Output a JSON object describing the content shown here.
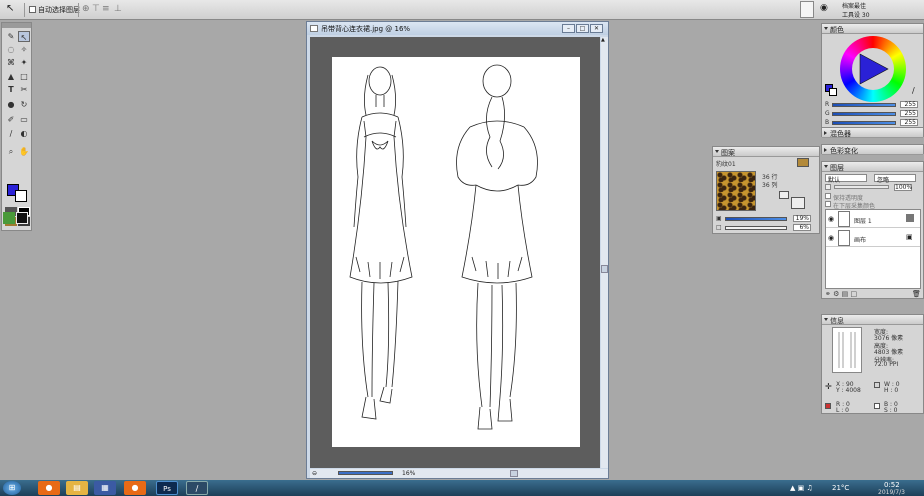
{
  "options_bar": {
    "auto_select_label": "自动选择图层"
  },
  "document": {
    "title": "吊带背心连衣裙.jpg @ 16%",
    "zoom": "16%"
  },
  "topright": {
    "row1": "档案最佳",
    "row2": "工具设 30"
  },
  "color_panel": {
    "title": "颜色",
    "channels": [
      {
        "label": "R",
        "value": "255"
      },
      {
        "label": "G",
        "value": "255"
      },
      {
        "label": "B",
        "value": "255"
      }
    ],
    "fg_color": "#2a21d6"
  },
  "color_sets_panel": {
    "title": "混色器"
  },
  "patterns_panel": {
    "title": "图案",
    "pattern_name": "豹纹01",
    "rows": "36 行",
    "cols": "36 列",
    "percent1": "19%",
    "percent2": "6%"
  },
  "color_var_panel": {
    "title": "色彩变化"
  },
  "layers_panel": {
    "title": "图层",
    "blend_mode": "默认",
    "composite": "忽略",
    "opacity": "100%",
    "opt1": "保持透明度",
    "opt2": "在下层采集颜色",
    "layers": [
      {
        "name": "图层 1"
      },
      {
        "name": "画布"
      }
    ]
  },
  "info_panel": {
    "title": "信息",
    "width_label": "宽度:",
    "width_value": "3076 像素",
    "height_label": "高度:",
    "height_value": "4803 像素",
    "res_label": "分辨率:",
    "res_value": "72.0 PPI",
    "x_label": "X : 90",
    "y_label": "Y : 4008",
    "w_label": "W : 0",
    "h_label": "H : 0",
    "r_label": "R : 0",
    "l_label": "L : 0",
    "b_label": "B : 0",
    "s_label": "S : 0"
  },
  "taskbar": {
    "temperature": "21°C",
    "time": "0:52",
    "date": "2019/7/3"
  }
}
